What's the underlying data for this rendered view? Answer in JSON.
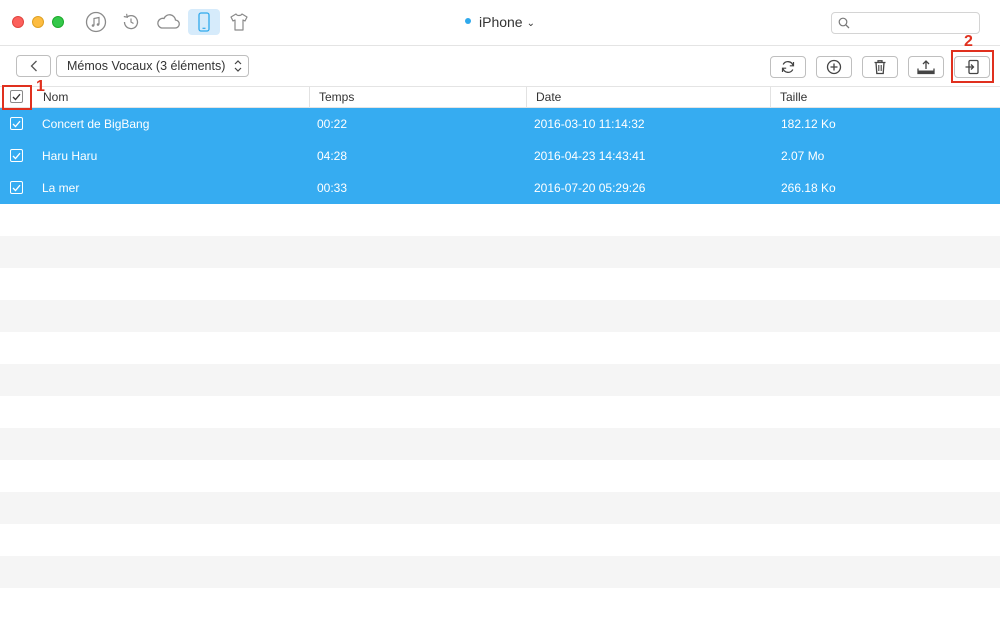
{
  "titlebar": {
    "device_name": "iPhone",
    "search": {
      "placeholder": "",
      "value": ""
    },
    "nav_icons": [
      "itunes-icon",
      "restore-icon",
      "icloud-icon",
      "iphone-icon",
      "tshirt-icon"
    ]
  },
  "toolbar": {
    "category_label": "Mémos Vocaux (3 éléments)",
    "actions": [
      "refresh-icon",
      "add-icon",
      "trash-icon",
      "export-to-pc-icon",
      "import-to-device-icon"
    ]
  },
  "table": {
    "columns": [
      "Nom",
      "Temps",
      "Date",
      "Taille"
    ],
    "rows": [
      {
        "nom": "Concert de BigBang",
        "temps": "00:22",
        "date": "2016-03-10 11:14:32",
        "taille": "182.12 Ko",
        "checked": true
      },
      {
        "nom": "Haru Haru",
        "temps": "04:28",
        "date": "2016-04-23 14:43:41",
        "taille": "2.07 Mo",
        "checked": true
      },
      {
        "nom": "La mer",
        "temps": "00:33",
        "date": "2016-07-20 05:29:26",
        "taille": "266.18 Ko",
        "checked": true
      }
    ]
  },
  "annotations": {
    "step1": "1",
    "step2": "2"
  },
  "colors": {
    "selection": "#36acf1",
    "highlight": "#e0301e",
    "accent": "#2fa9ec"
  }
}
